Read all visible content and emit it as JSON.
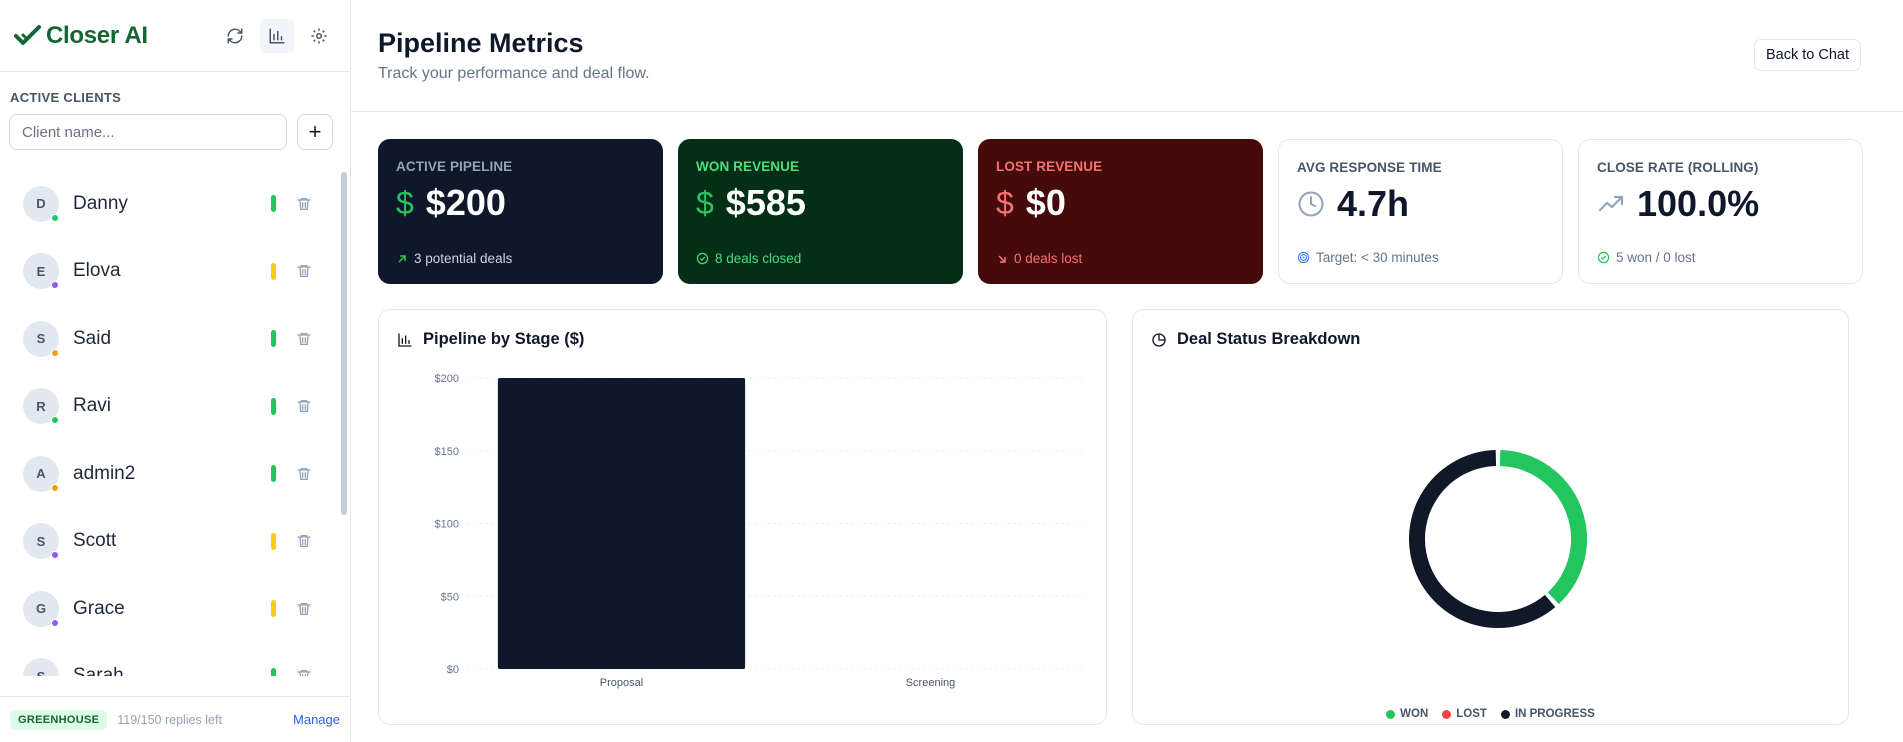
{
  "brand": {
    "name": "Closer AI"
  },
  "sidebar": {
    "section_label": "ACTIVE CLIENTS",
    "client_input_placeholder": "Client name...",
    "add_label": "+",
    "clients": [
      {
        "initial": "D",
        "name": "Danny",
        "status_color": "#22c55e",
        "heat_color": "#22c55e"
      },
      {
        "initial": "E",
        "name": "Elova",
        "status_color": "#8b5cf6",
        "heat_color": "#facc15"
      },
      {
        "initial": "S",
        "name": "Said",
        "status_color": "#f59e0b",
        "heat_color": "#22c55e"
      },
      {
        "initial": "R",
        "name": "Ravi",
        "status_color": "#22c55e",
        "heat_color": "#22c55e"
      },
      {
        "initial": "A",
        "name": "admin2",
        "status_color": "#f59e0b",
        "heat_color": "#22c55e"
      },
      {
        "initial": "S",
        "name": "Scott",
        "status_color": "#8b5cf6",
        "heat_color": "#facc15"
      },
      {
        "initial": "G",
        "name": "Grace",
        "status_color": "#8b5cf6",
        "heat_color": "#facc15"
      },
      {
        "initial": "S",
        "name": "Sarah",
        "status_color": "#22c55e",
        "heat_color": "#22c55e"
      }
    ],
    "footer": {
      "plan": "GREENHOUSE",
      "replies": "119/150 replies left",
      "manage": "Manage"
    }
  },
  "header": {
    "title": "Pipeline Metrics",
    "subtitle": "Track your performance and deal flow.",
    "back_button": "Back to Chat"
  },
  "kpis": {
    "active": {
      "label": "ACTIVE PIPELINE",
      "value": "$200",
      "foot": "3 potential deals",
      "accent": "#22c55e"
    },
    "won": {
      "label": "WON REVENUE",
      "value": "$585",
      "foot": "8 deals closed",
      "accent": "#22c55e"
    },
    "lost": {
      "label": "LOST REVENUE",
      "value": "$0",
      "foot": "0 deals lost",
      "accent": "#f87171"
    },
    "response": {
      "label": "AVG RESPONSE TIME",
      "value": "4.7h",
      "foot": "Target: < 30 minutes"
    },
    "close": {
      "label": "CLOSE RATE (ROLLING)",
      "value": "100.0%",
      "foot": "5 won / 0 lost"
    }
  },
  "bar_panel": {
    "title": "Pipeline by Stage ($)"
  },
  "donut_panel": {
    "title": "Deal Status Breakdown"
  },
  "chart_data": [
    {
      "type": "bar",
      "title": "Pipeline by Stage ($)",
      "categories": [
        "Proposal",
        "Screening"
      ],
      "values": [
        200,
        0
      ],
      "yticks": [
        "$0",
        "$50",
        "$100",
        "$150",
        "$200"
      ],
      "ylim": [
        0,
        200
      ],
      "bar_color": "#0f172a"
    },
    {
      "type": "pie",
      "title": "Deal Status Breakdown",
      "labels": [
        "WON",
        "LOST",
        "IN PROGRESS"
      ],
      "values": [
        5,
        0,
        8
      ],
      "colors": [
        "#22c55e",
        "#ef4444",
        "#111827"
      ]
    }
  ]
}
